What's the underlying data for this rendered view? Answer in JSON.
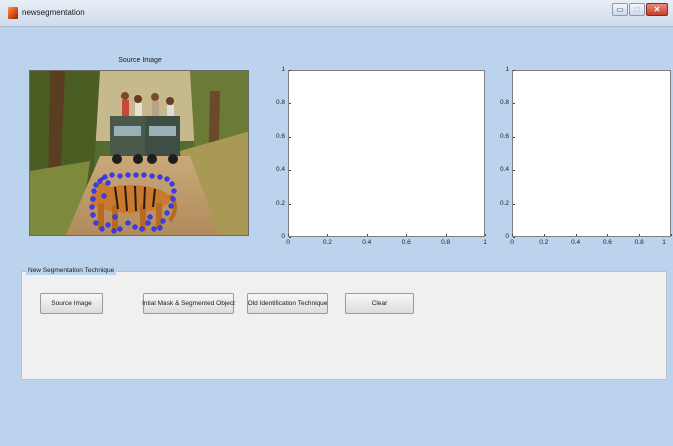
{
  "window": {
    "title": "newsegmentation",
    "buttons": {
      "minimize": "▭",
      "maximize": "□",
      "close": "✕"
    }
  },
  "source_image": {
    "label": "Source Image"
  },
  "axes1": {
    "yticks": [
      "1",
      "0.8",
      "0.6",
      "0.4",
      "0.2",
      "0"
    ],
    "xticks": [
      "0",
      "0.2",
      "0.4",
      "0.6",
      "0.8",
      "1"
    ]
  },
  "axes2": {
    "yticks": [
      "1",
      "0.8",
      "0.6",
      "0.4",
      "0.2",
      "0"
    ],
    "xticks": [
      "0",
      "0.2",
      "0.4",
      "0.6",
      "0.8",
      "1"
    ]
  },
  "panel": {
    "title": "New Segmentation Technique",
    "buttons": {
      "source_image": "Source Image",
      "initial_mask": "Intial Mask & Segmented Object",
      "old_technique": "Old Identification Technique",
      "clear": "Clear"
    }
  },
  "colors": {
    "background": "#bcd3ee",
    "panel": "#f0f0f0",
    "contour_points": "#3a3cf0"
  }
}
